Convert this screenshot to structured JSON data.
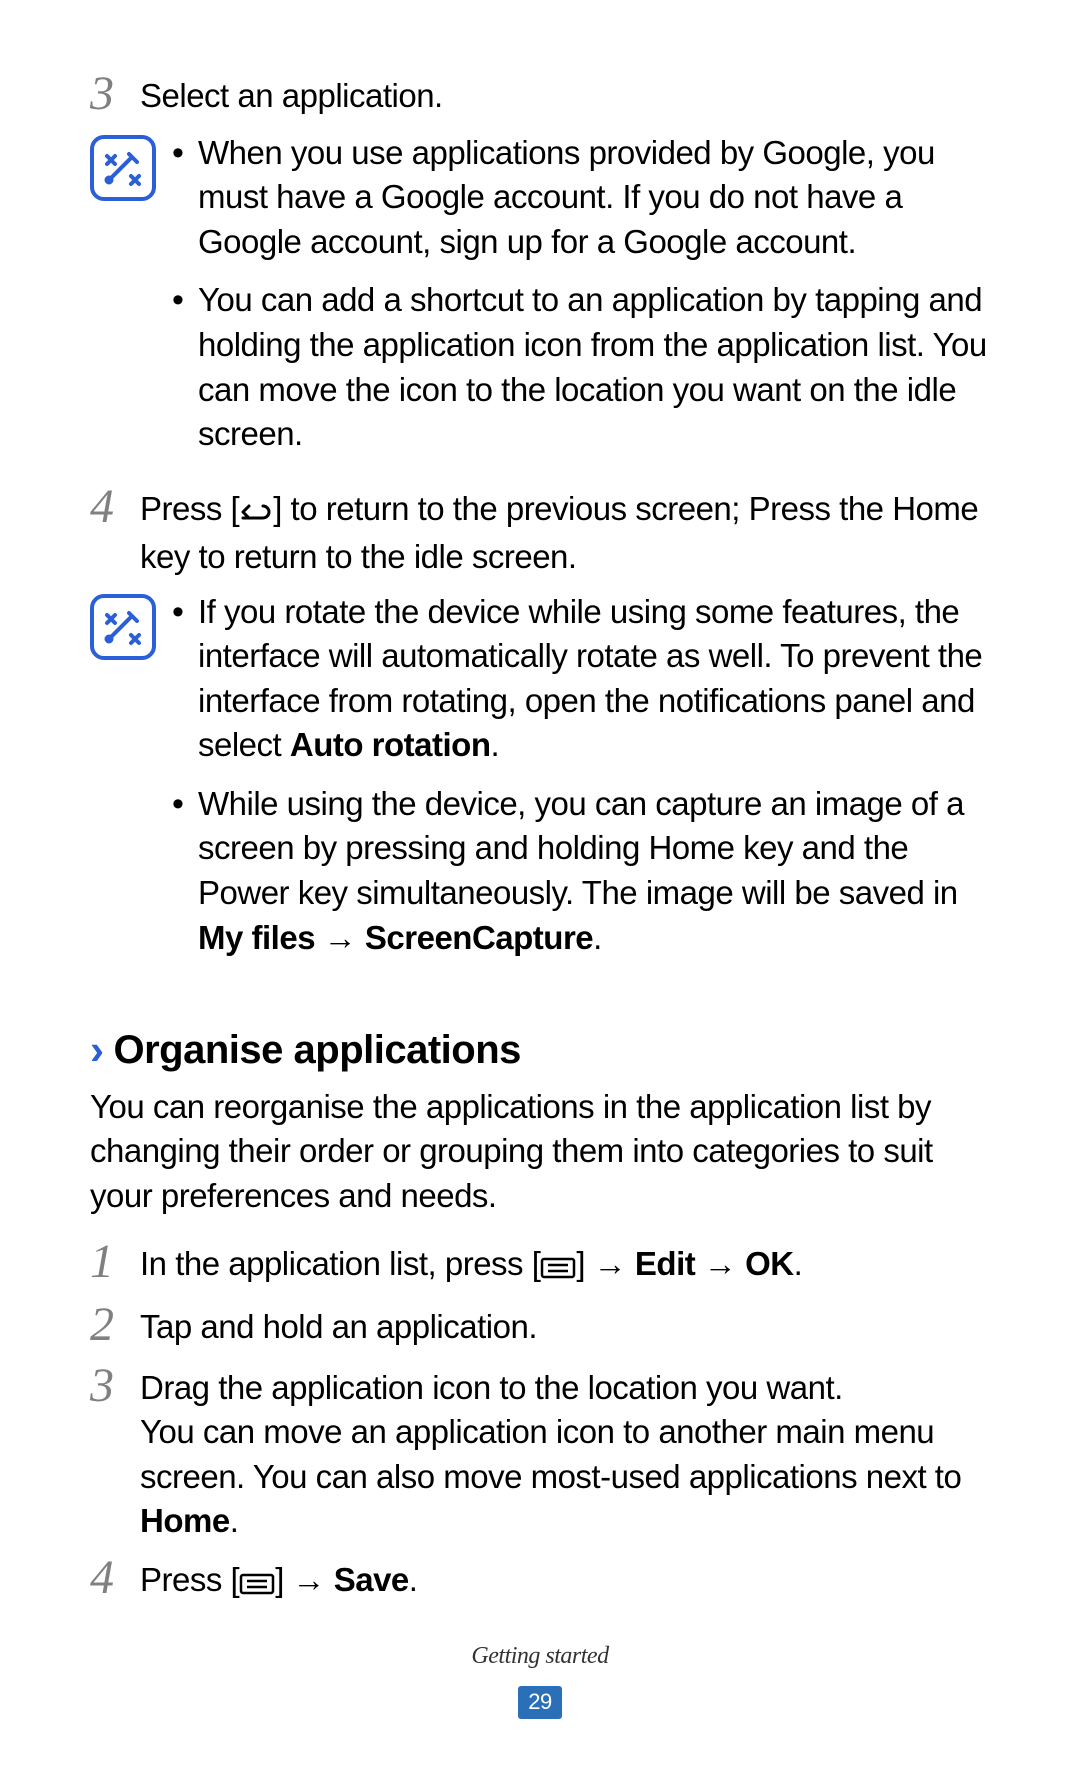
{
  "step3": {
    "num": "3",
    "text": "Select an application."
  },
  "note1": {
    "bullets": [
      {
        "pre": "When you use applications provided by Google, you must have a Google account. If you do not have a Google account, sign up for a Google account."
      },
      {
        "pre": "You can add a shortcut to an application by tapping and holding the application icon from the application list. You can move the icon to the location you want on the idle screen."
      }
    ]
  },
  "step4a": {
    "num": "4",
    "pre": "Press [",
    "post": "] to return to the previous screen; Press the Home key to return to the idle screen."
  },
  "note2": {
    "bullets": [
      {
        "pre": "If you rotate the device while using some features, the interface will automatically rotate as well. To prevent the interface from rotating, open the notifications panel and select ",
        "bold": "Auto rotation",
        "post": "."
      },
      {
        "pre": "While using the device, you can capture an image of a screen by pressing and holding Home key and the Power key simultaneously. The image will be saved in ",
        "bold": "My files → ScreenCapture",
        "post": "."
      }
    ]
  },
  "section": {
    "chevron": "›",
    "title": "Organise applications",
    "intro": "You can reorganise the applications in the application list by changing their order or grouping them into categories to suit your preferences and needs."
  },
  "org_steps": {
    "s1": {
      "num": "1",
      "pre": "In the application list, press [",
      "post": "] → ",
      "bold": "Edit → OK",
      "tail": "."
    },
    "s2": {
      "num": "2",
      "text": "Tap and hold an application."
    },
    "s3": {
      "num": "3",
      "line1": "Drag the application icon to the location you want.",
      "line2a": "You can move an application icon to another main menu screen. You can also move most-used applications next to ",
      "bold": "Home",
      "line2b": "."
    },
    "s4": {
      "num": "4",
      "pre": "Press [",
      "post": "] → ",
      "bold": "Save",
      "tail": "."
    }
  },
  "footer": {
    "title": "Getting started",
    "page": "29"
  }
}
